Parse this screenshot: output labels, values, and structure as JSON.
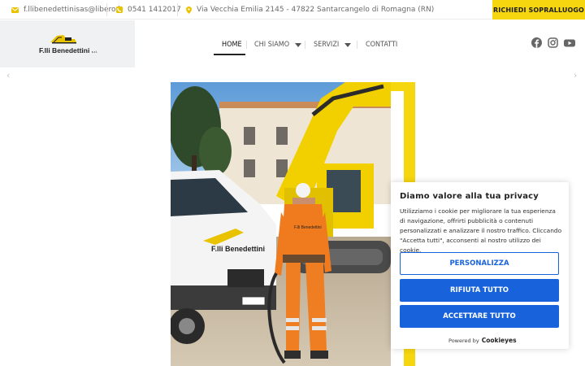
{
  "topbar": {
    "email": "f.llibenedettinisas@libero.it",
    "phone": "0541 1412017",
    "address": "Via Vecchia Emilia 2145 - 47822 Santarcangelo di Romagna (RN)",
    "cta_label": "RICHIEDI SOPRALLUOGO"
  },
  "logo": {
    "name": "F.lli Benedettini",
    "suffix": "s.r.l."
  },
  "nav": {
    "items": [
      {
        "label": "HOME",
        "active": true
      },
      {
        "label": "CHI SIAMO",
        "dropdown": true
      },
      {
        "label": "SERVIZI",
        "dropdown": true
      },
      {
        "label": "CONTATTI"
      }
    ]
  },
  "social": [
    "facebook-icon",
    "instagram-icon",
    "youtube-icon"
  ],
  "hero": {
    "van_brand": "F.lli Benedettini",
    "shirt_text": "F.lli Benedettini"
  },
  "cookie": {
    "title": "Diamo valore alla tua privacy",
    "body": "Utilizziamo i cookie per migliorare la tua esperienza di navigazione, offrirti pubblicità o contenuti personalizzati e analizzare il nostro traffico. Cliccando \"Accetta tutti\", acconsenti al nostro utilizzo dei cookie.",
    "customize_label": "PERSONALIZZA",
    "reject_label": "RIFIUTA TUTTO",
    "accept_label": "ACCETTARE TUTTO",
    "powered_by": "Powered by",
    "powered_brand": "Cookieyes"
  },
  "colors": {
    "brand_yellow": "#f6d60e",
    "cookie_blue": "#1863dc"
  }
}
